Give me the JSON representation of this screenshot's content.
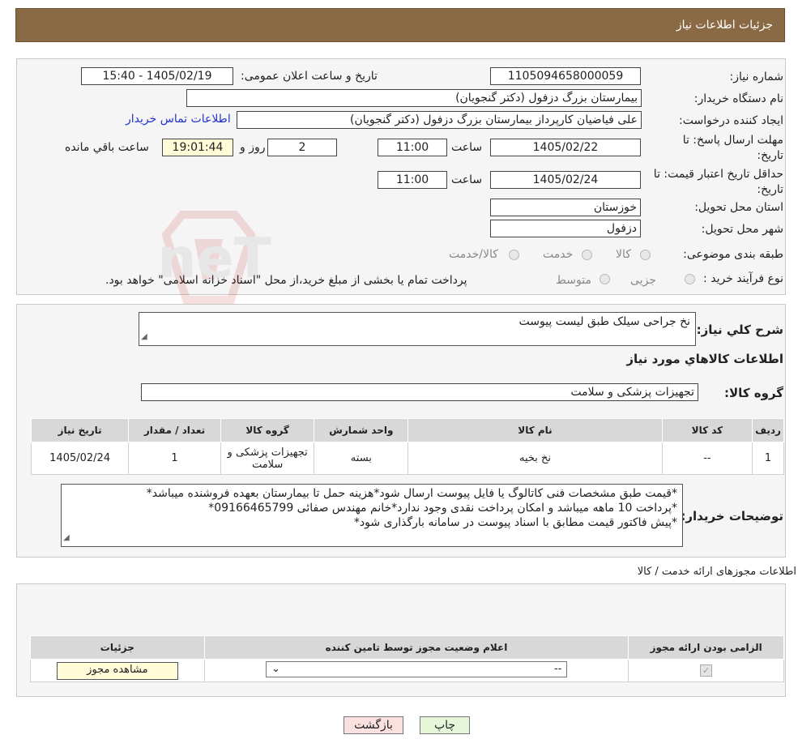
{
  "header": {
    "title": "جزئیات اطلاعات نیاز"
  },
  "form": {
    "need_number_label": "شماره نیاز:",
    "need_number": "1105094658000059",
    "announce_label": "تاریخ و ساعت اعلان عمومی:",
    "announce_value": "1405/02/19 - 15:40",
    "buyer_org_label": "نام دستگاه خریدار:",
    "buyer_org": "بیمارستان بزرگ دزفول (دکتر گنجویان)",
    "creator_label": "ایجاد کننده درخواست:",
    "creator": "علی فیاضیان کارپرداز بیمارستان بزرگ دزفول (دکتر گنجویان)",
    "contact_link": "اطلاعات تماس خریدار",
    "deadline_label": "مهلت ارسال پاسخ: تا تاریخ:",
    "deadline_date": "1405/02/22",
    "time_label": "ساعت",
    "deadline_time": "11:00",
    "days_value": "2",
    "days_label": "روز و",
    "remaining_time": "19:01:44",
    "remaining_label": "ساعت باقي مانده",
    "validity_label": "حداقل تاریخ اعتبار قیمت: تا تاریخ:",
    "validity_date": "1405/02/24",
    "validity_time": "11:00",
    "province_label": "استان محل تحویل:",
    "province": "خوزستان",
    "city_label": "شهر محل تحویل:",
    "city": "دزفول",
    "category_label": "طبقه بندی موضوعی:",
    "category_options": [
      "کالا",
      "خدمت",
      "کالا/خدمت"
    ],
    "process_label": "نوع فرآیند خرید :",
    "process_options": [
      "جزیی",
      "متوسط"
    ],
    "process_note": "پرداخت تمام یا بخشی از مبلغ خرید،از محل \"اسناد خزانه اسلامی\" خواهد بود."
  },
  "summary": {
    "label": "شرح کلي نیاز:",
    "value": "نخ جراحی سیلک طبق لیست پیوست",
    "goods_info_title": "اطلاعات کالاهاي مورد نیاز",
    "group_label": "گروه کالا:",
    "group_value": "تجهیزات پزشکی و سلامت"
  },
  "goods_table": {
    "headers": [
      "ردیف",
      "کد کالا",
      "نام کالا",
      "واحد شمارش",
      "گروه کالا",
      "تعداد / مقدار",
      "تاریخ نیاز"
    ],
    "rows": [
      [
        "1",
        "--",
        "نخ بخیه",
        "بسته",
        "تجهیزات پزشکی و سلامت",
        "1",
        "1405/02/24"
      ]
    ]
  },
  "buyer_notes": {
    "label": "توضیحات خریدار:",
    "lines": [
      "*قیمت طبق مشخصات فنی کاتالوگ یا فایل پیوست ارسال شود*هزینه حمل تا بیمارستان بعهده فروشنده میباشد*",
      "*پرداخت 10 ماهه میباشد و امکان پرداخت نقدی وجود ندارد*خانم مهندس صفائی 09166465799*",
      "*پیش فاکتور قیمت مطابق با اسناد پیوست در سامانه بارگذاری شود*"
    ]
  },
  "permits": {
    "title": "اطلاعات مجوزهای ارائه خدمت / کالا",
    "headers": [
      "الزامی بودن ارائه مجوز",
      "اعلام وضعیت مجوز توسط تامین کننده",
      "جزئیات"
    ],
    "select_value": "--",
    "view_button": "مشاهده مجوز"
  },
  "footer": {
    "print_button": "چاپ",
    "back_button": "بازگشت"
  },
  "watermark_text": "AriaTender.neT",
  "colors": {
    "header_bg": "#8a6a45",
    "link": "#2233cc",
    "print_bg": "#e6f7d9",
    "back_bg": "#fbe0e0"
  }
}
